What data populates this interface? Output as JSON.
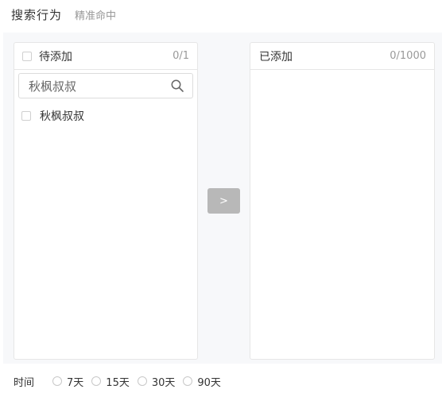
{
  "header": {
    "title": "搜索行为",
    "subtitle": "精准命中"
  },
  "left_panel": {
    "title": "待添加",
    "count": "0/1",
    "search": {
      "value": "秋枫叔叔",
      "placeholder": ""
    },
    "items": [
      {
        "label": "秋枫叔叔",
        "checked": false
      }
    ]
  },
  "transfer": {
    "label": ">"
  },
  "right_panel": {
    "title": "已添加",
    "count": "0/1000",
    "items": []
  },
  "time": {
    "label": "时间",
    "options": [
      {
        "label": "7天",
        "selected": false
      },
      {
        "label": "15天",
        "selected": false
      },
      {
        "label": "30天",
        "selected": false
      },
      {
        "label": "90天",
        "selected": false
      }
    ]
  },
  "icons": {
    "search": "search-icon"
  },
  "colors": {
    "button_disabled": "#b8b8b8",
    "border": "#e6e6e6",
    "muted_text": "#999999",
    "area_bg": "#f7f8fa"
  }
}
